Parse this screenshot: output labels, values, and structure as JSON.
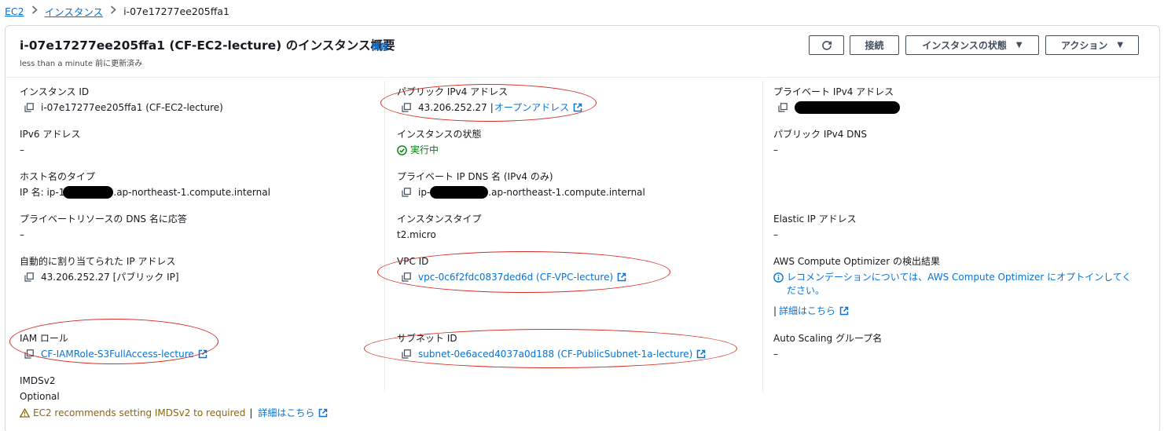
{
  "breadcrumb": {
    "ec2": "EC2",
    "instances": "インスタンス",
    "current": "i-07e17277ee205ffa1"
  },
  "header": {
    "title": "i-07e17277ee205ffa1 (CF-EC2-lecture) のインスタンス概要",
    "info": "情報",
    "updated": "less than a minute 前に更新済み",
    "buttons": {
      "connect": "接続",
      "state": "インスタンスの状態",
      "actions": "アクション"
    }
  },
  "col1": {
    "instance_id": {
      "label": "インスタンス ID",
      "value": "i-07e17277ee205ffa1 (CF-EC2-lecture)"
    },
    "ipv6": {
      "label": "IPv6 アドレス",
      "value": "–"
    },
    "hostname_type": {
      "label": "ホスト名のタイプ",
      "prefix": "IP 名: ip-1",
      "suffix": ".ap-northeast-1.compute.internal"
    },
    "private_dns_answer": {
      "label": "プライベートリソースの DNS 名に応答",
      "value": "–"
    },
    "auto_ip": {
      "label": "自動的に割り当てられた IP アドレス",
      "value": "43.206.252.27 [パブリック IP]"
    },
    "iam_role": {
      "label": "IAM ロール",
      "value": "CF-IAMRole-S3FullAccess-lecture"
    },
    "imdsv2": {
      "label": "IMDSv2",
      "value": "Optional",
      "warning": "EC2 recommends setting IMDSv2 to required",
      "link": "詳細はこちら",
      "sep": "|"
    }
  },
  "col2": {
    "public_ipv4": {
      "label": "パブリック IPv4 アドレス",
      "value": "43.206.252.27",
      "sep": "|",
      "link": "オープンアドレス"
    },
    "instance_state": {
      "label": "インスタンスの状態",
      "value": "実行中"
    },
    "private_ip_dns": {
      "label": "プライベート IP DNS 名 (IPv4 のみ)",
      "prefix": "ip-",
      "suffix": ".ap-northeast-1.compute.internal"
    },
    "instance_type": {
      "label": "インスタンスタイプ",
      "value": "t2.micro"
    },
    "vpc_id": {
      "label": "VPC ID",
      "value": "vpc-0c6f2fdc0837ded6d (CF-VPC-lecture)"
    },
    "subnet_id": {
      "label": "サブネット ID",
      "value": "subnet-0e6aced4037a0d188 (CF-PublicSubnet-1a-lecture)"
    }
  },
  "col3": {
    "private_ipv4": {
      "label": "プライベート IPv4 アドレス"
    },
    "public_ipv4_dns": {
      "label": "パブリック IPv4 DNS",
      "value": "–"
    },
    "elastic_ip": {
      "label": "Elastic IP アドレス",
      "value": "–"
    },
    "optimizer": {
      "label": "AWS Compute Optimizer の検出結果",
      "line1": "レコメンデーションについては、AWS Compute Optimizer にオプトインしてく",
      "line2": "ださい。",
      "sep": "|",
      "link": "詳細はこちら"
    },
    "autoscaling": {
      "label": "Auto Scaling グループ名",
      "value": "–"
    }
  },
  "colors": {
    "link": "#0972d3",
    "success": "#037f0c",
    "warning": "#8d6605",
    "annotation": "#d42b21"
  },
  "icons": [
    "chevron-right-icon",
    "refresh-icon",
    "caret-down-icon",
    "copy-icon",
    "external-link-icon",
    "check-circle-icon",
    "info-circle-icon",
    "warning-icon"
  ]
}
